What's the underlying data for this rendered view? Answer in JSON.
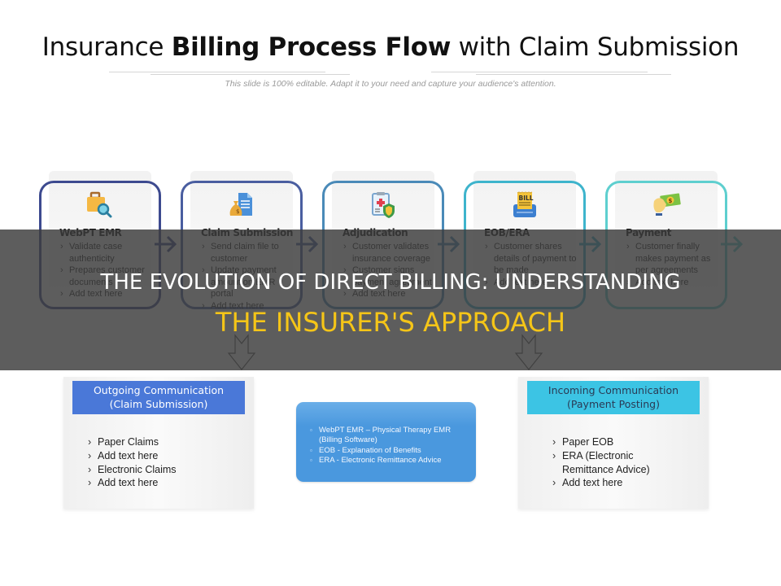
{
  "slide": {
    "title": {
      "part1": "Insurance ",
      "bold": "Billing Process Flow",
      "part2": " with Claim Submission"
    },
    "subtitle": "This slide is 100% editable. Adapt it to your need and capture your audience's attention."
  },
  "steps": [
    {
      "heading": "WebPT EMR",
      "icon": "briefcase-search-icon",
      "border_color": "#3d4a8f",
      "bullets": [
        "Validate case authenticity",
        "Prepares customer documents",
        "Add text here"
      ]
    },
    {
      "heading": "Claim Submission",
      "icon": "money-bag-document-icon",
      "border_color": "#4a5ea0",
      "bullets": [
        "Send claim file to customer",
        "Update payment amount on EMR portal",
        "Add text here"
      ]
    },
    {
      "heading": "Adjudication",
      "icon": "clipboard-shield-icon",
      "border_color": "#4a8ab8",
      "bullets": [
        "Customer validates insurance coverage",
        "Customer signs payment agreement",
        "Add text here"
      ]
    },
    {
      "heading": "EOB/ERA",
      "icon": "bill-icon",
      "border_color": "#3eb4cc",
      "bullets": [
        "Customer shares details of payment to be made",
        "Add text here"
      ]
    },
    {
      "heading": "Payment",
      "icon": "hand-cash-icon",
      "border_color": "#5ecfcf",
      "bullets": [
        "Customer finally makes payment as per agreements",
        "Add text here"
      ]
    }
  ],
  "outgoing": {
    "title_line1": "Outgoing Communication",
    "title_line2": "(Claim Submission)",
    "color": "#4a78d8",
    "bullets": [
      "Paper Claims",
      "Add text here",
      "Electronic Claims",
      "Add text here"
    ]
  },
  "center_note": {
    "color": "#4a98de",
    "bullets": [
      "WebPT EMR – Physical Therapy EMR (Billing Software)",
      "EOB - Explanation of Benefits",
      "ERA - Electronic Remittance Advice"
    ]
  },
  "incoming": {
    "title_line1": "Incoming Communication",
    "title_line2": "(Payment Posting)",
    "color": "#3cc4e4",
    "bullets": [
      "Paper EOB",
      "ERA (Electronic Remittance Advice)",
      "Add text here"
    ]
  },
  "overlay": {
    "line1": "THE EVOLUTION OF DIRECT BILLING: UNDERSTANDING",
    "line2": "THE INSURER'S APPROACH",
    "line2_color": "#f5c518"
  }
}
